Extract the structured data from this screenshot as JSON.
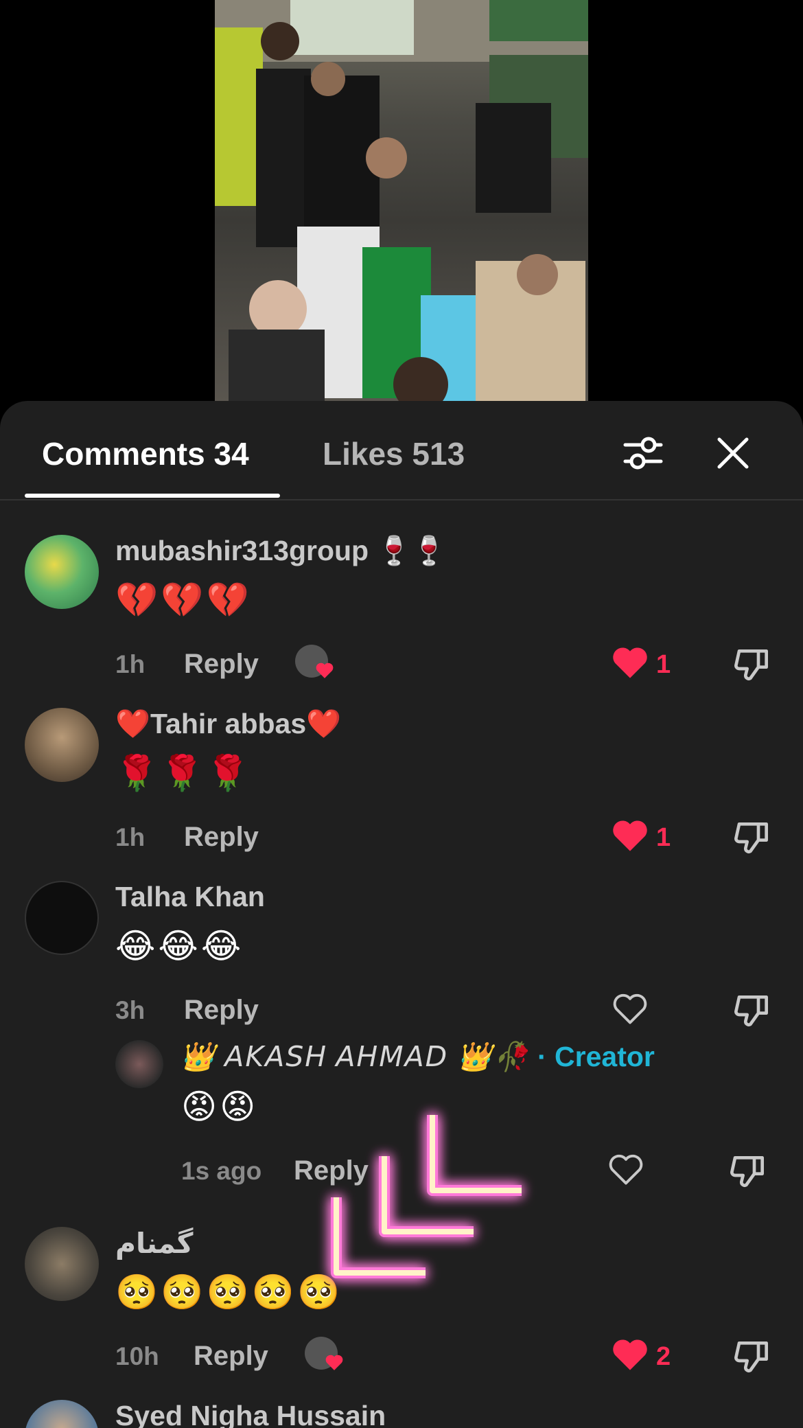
{
  "tabs": {
    "comments": "Comments 34",
    "likes": "Likes 513"
  },
  "icons": {
    "filter": "filter-sliders-icon",
    "close": "close-icon",
    "heart": "heart-icon",
    "dislike": "dislike-icon"
  },
  "colors": {
    "accent_like": "#fe2c55",
    "creator": "#20b5d6",
    "sheet": "#1f1f1f"
  },
  "comments": [
    {
      "user": "mubashir313group 🍷🍷",
      "text": "💔💔💔",
      "time": "1h",
      "reply": "Reply",
      "likes": "1"
    },
    {
      "user": "❤️Tahir abbas❤️",
      "text": "🌹🌹🌹",
      "time": "1h",
      "reply": "Reply",
      "likes": "1"
    },
    {
      "user": "Talha Khan",
      "text": "😂😂😂",
      "time": "3h",
      "reply": "Reply",
      "likes": "",
      "replies": [
        {
          "user": "👑 𝘈𝘒𝘈𝘚𝘏 𝘈𝘏𝘔𝘈𝘋 👑🥀",
          "badge": "· Creator",
          "text": "😡😡",
          "time": "1s ago",
          "reply": "Reply"
        }
      ]
    },
    {
      "user": "گمنام",
      "text": "🥺🥺🥺🥺🥺",
      "time": "10h",
      "reply": "Reply",
      "likes": "2"
    },
    {
      "user": "Syed Nigha Hussain"
    }
  ]
}
